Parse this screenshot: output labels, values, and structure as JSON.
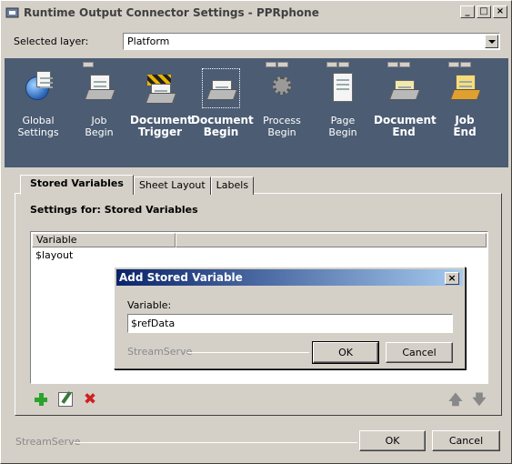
{
  "window": {
    "title": "Runtime Output Connector Settings - PPRphone",
    "controls": [
      "_",
      "□",
      "×"
    ]
  },
  "layer": {
    "label": "Selected layer:",
    "value": "Platform"
  },
  "events": [
    {
      "label_1": "Global",
      "label_2": "Settings",
      "icon": "globe-settings-icon",
      "bold": false
    },
    {
      "label_1": "Job",
      "label_2": "Begin",
      "icon": "job-begin-icon",
      "bold": false
    },
    {
      "label_1": "Document",
      "label_2": "Trigger",
      "icon": "document-trigger-icon",
      "bold": true
    },
    {
      "label_1": "Document",
      "label_2": "Begin",
      "icon": "document-begin-icon",
      "bold": true,
      "selected": true
    },
    {
      "label_1": "Process",
      "label_2": "Begin",
      "icon": "process-begin-icon",
      "bold": false
    },
    {
      "label_1": "Page",
      "label_2": "Begin",
      "icon": "page-begin-icon",
      "bold": false
    },
    {
      "label_1": "Document",
      "label_2": "End",
      "icon": "document-end-icon",
      "bold": true
    },
    {
      "label_1": "Job",
      "label_2": "End",
      "icon": "job-end-icon",
      "bold": true
    }
  ],
  "tabs": [
    {
      "label": "Stored Variables",
      "active": true
    },
    {
      "label": "Sheet Layout",
      "active": false
    },
    {
      "label": "Labels",
      "active": false
    }
  ],
  "panel": {
    "settings_for": "Settings for: Stored Variables",
    "column_header": "Variable",
    "rows": [
      "$layout"
    ]
  },
  "dialog": {
    "title": "Add Stored Variable",
    "close": "×",
    "variable_label": "Variable:",
    "variable_value": "$refData",
    "brand": "StreamServe",
    "ok": "OK",
    "cancel": "Cancel"
  },
  "footer": {
    "brand": "StreamServe",
    "ok": "OK",
    "cancel": "Cancel"
  },
  "colors": {
    "toolbar_bg": "#4b5c73",
    "dialog_title_start": "#0a246a",
    "dialog_title_end": "#a6caf0",
    "add_icon": "#2aa32a",
    "delete_icon": "#d02020"
  }
}
